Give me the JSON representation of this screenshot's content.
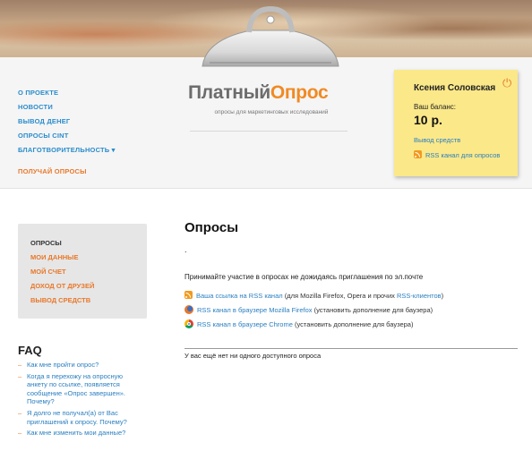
{
  "top_nav": [
    {
      "label": "О проекте"
    },
    {
      "label": "Новости"
    },
    {
      "label": "Вывод денег"
    },
    {
      "label": "Опросы CINT"
    },
    {
      "label": "Благотворительность ▾"
    },
    {
      "label": "Получай опросы"
    }
  ],
  "logo": {
    "part1": "Платный",
    "part2": "Опрос",
    "tagline": "опросы для маркетинговых исследований"
  },
  "account": {
    "name": "Ксения Соловская",
    "balance_label": "Ваш баланс:",
    "balance_value": "10 р.",
    "withdraw_link": "Вывод средств",
    "rss_link": "RSS канал для опросов",
    "power_icon": "⏻"
  },
  "side_menu": [
    {
      "label": "Опросы",
      "active": true
    },
    {
      "label": "Мои данные"
    },
    {
      "label": "Мой счет"
    },
    {
      "label": "Доход от друзей"
    },
    {
      "label": "Вывод средств"
    }
  ],
  "faq": {
    "title": "FAQ",
    "items": [
      "Как мне пройти опрос?",
      "Когда я перехожу на опросную анкету по ссылке, появляется сообщение «Опрос завершен». Почему?",
      "Я долго не получал(а) от Вас приглашений к опросу. Почему?",
      "Как мне изменить мои данные?"
    ]
  },
  "main": {
    "title": "Опросы",
    "dot": ".",
    "intro": "Принимайте участие в опросах не дожидаясь приглашения по эл.почте",
    "links": [
      {
        "link": "Ваша ссылка на RSS канал",
        "mid": " (для Mozilla Firefox, Opera и прочих ",
        "link2": "RSS-клиентов",
        "end": ")"
      },
      {
        "link": "RSS канал в браузере Mozilla Firefox",
        "rest": " (установить дополнение для баузера)"
      },
      {
        "link": "RSS канал в браузере Chrome",
        "rest": " (установить дополнение для баузера)"
      }
    ],
    "empty_message": "У вас ещё нет ни одного доступного опроса"
  },
  "colors": {
    "accent_blue": "#2a7fc1",
    "accent_orange": "#e8782a",
    "sticky_yellow": "#fbe889"
  }
}
